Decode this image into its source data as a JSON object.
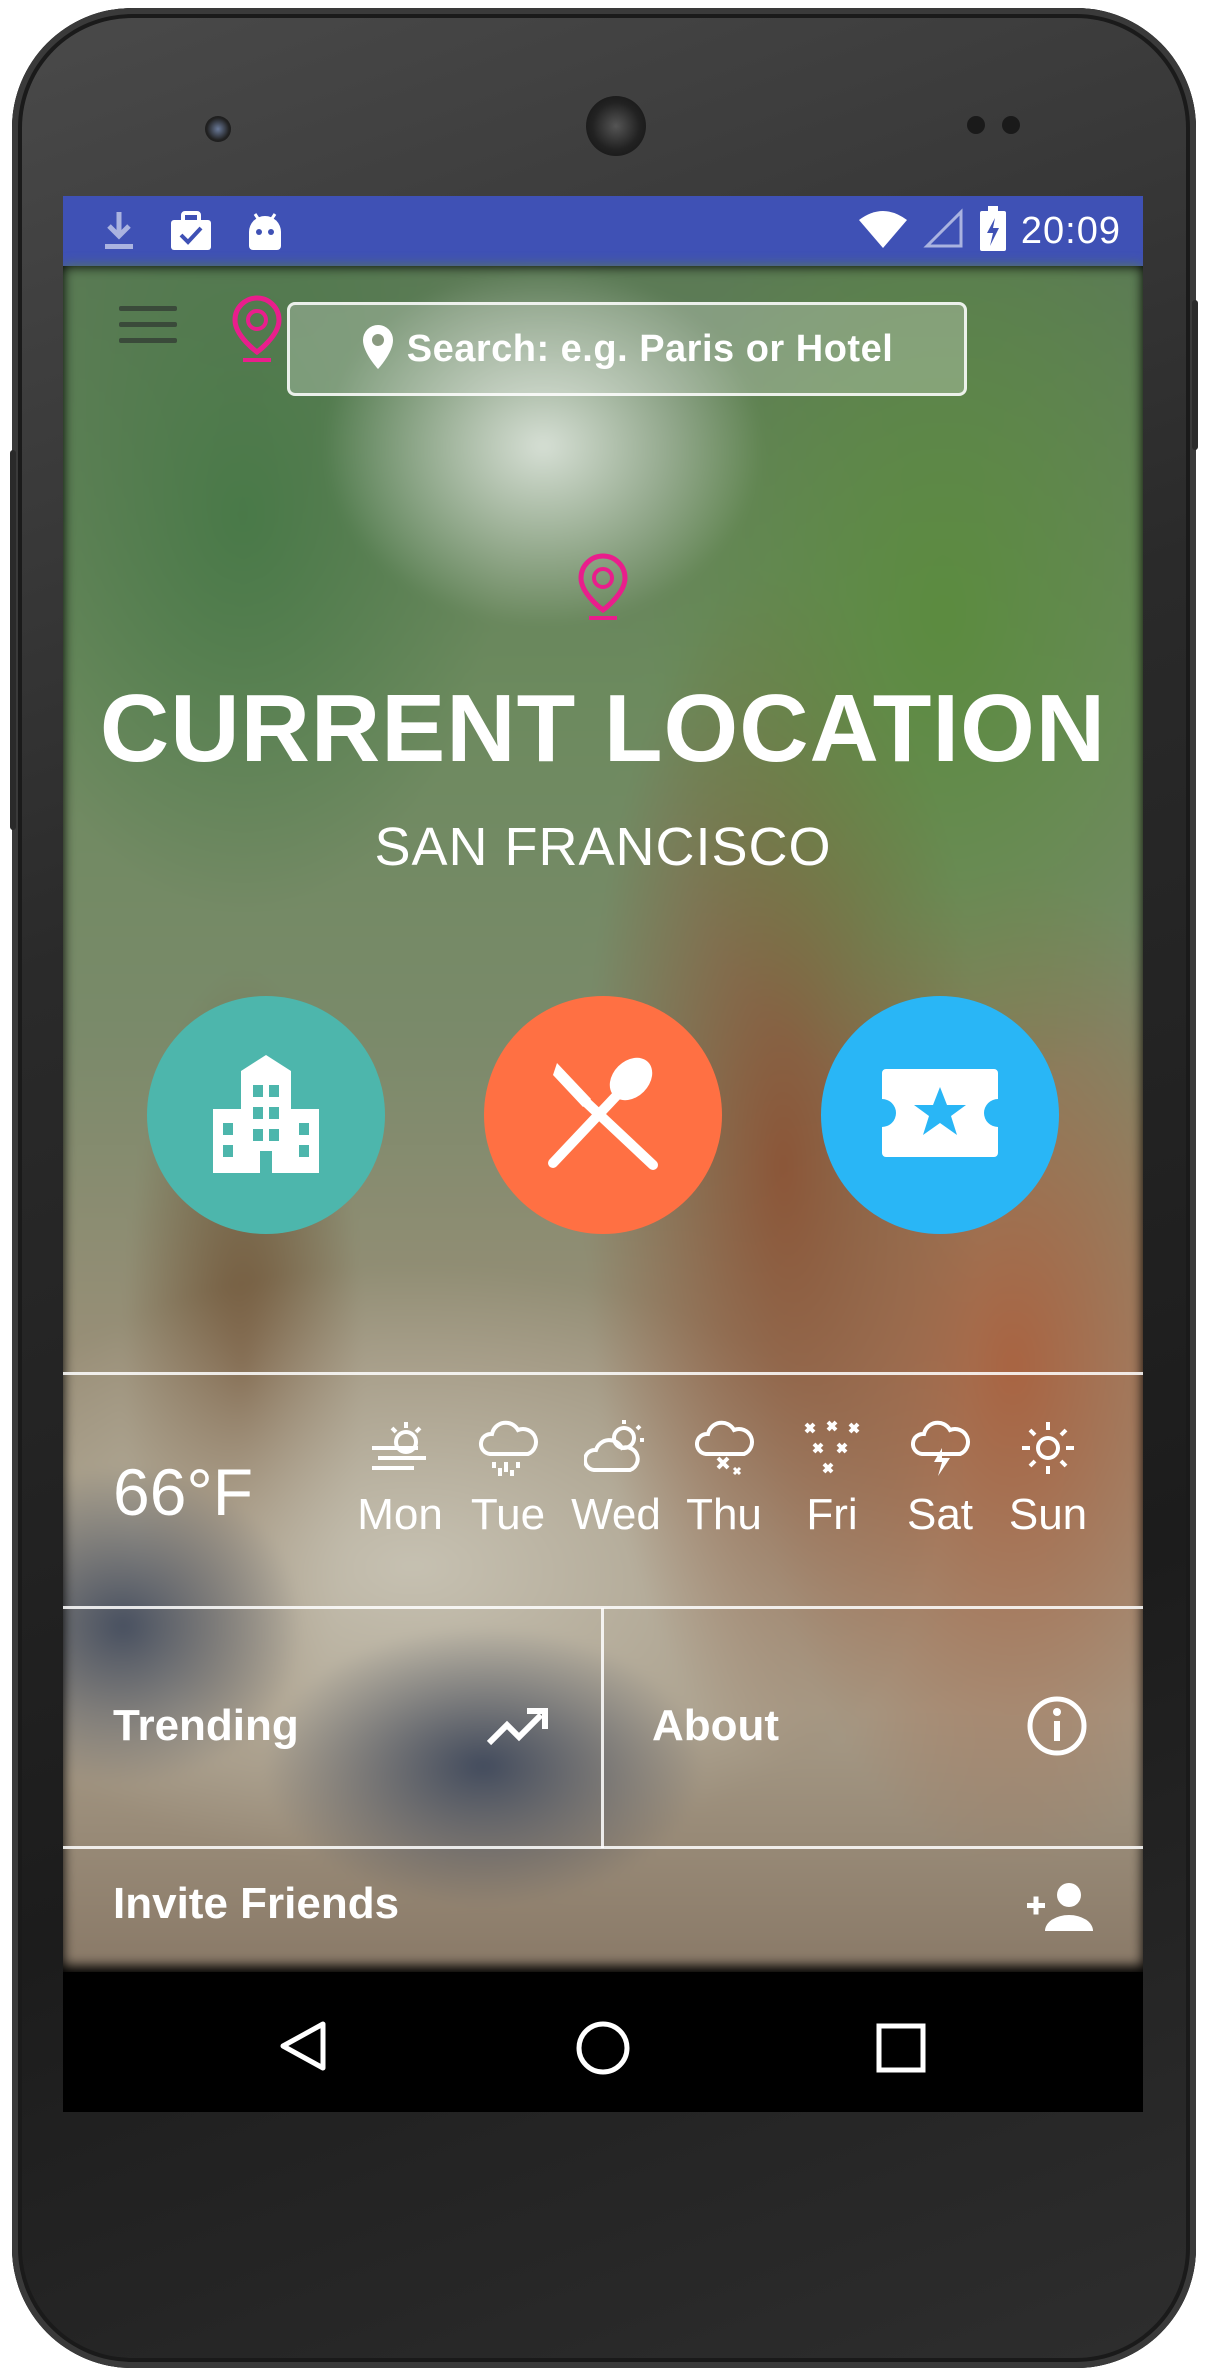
{
  "status_bar": {
    "time": "20:09",
    "left_icons": [
      "download-icon",
      "briefcase-check-icon",
      "android-icon"
    ],
    "right_icons": [
      "wifi-icon",
      "signal-icon",
      "battery-charging-icon"
    ],
    "color": "#3f51b5"
  },
  "toolbar": {
    "search_placeholder": "Search: e.g. Paris or Hotel",
    "logo_color": "#e91e8c"
  },
  "header": {
    "title": "CURRENT LOCATION",
    "subtitle": "SAN FRANCISCO"
  },
  "categories": [
    {
      "name": "hotels",
      "icon": "building-icon",
      "color": "#4db6ac"
    },
    {
      "name": "restaurants",
      "icon": "fork-knife-icon",
      "color": "#ff7043"
    },
    {
      "name": "attractions",
      "icon": "ticket-star-icon",
      "color": "#29b6f6"
    }
  ],
  "weather": {
    "temperature": "66°F",
    "days": [
      {
        "label": "Mon",
        "icon": "windy-sun-icon"
      },
      {
        "label": "Tue",
        "icon": "rain-cloud-icon"
      },
      {
        "label": "Wed",
        "icon": "partly-cloudy-icon"
      },
      {
        "label": "Thu",
        "icon": "snow-cloud-icon"
      },
      {
        "label": "Fri",
        "icon": "snowflakes-icon"
      },
      {
        "label": "Sat",
        "icon": "thunder-cloud-icon"
      },
      {
        "label": "Sun",
        "icon": "sun-icon"
      }
    ]
  },
  "tiles": {
    "trending": "Trending",
    "about": "About",
    "invite": "Invite Friends"
  },
  "nav": [
    "back-icon",
    "home-icon",
    "recents-icon"
  ]
}
